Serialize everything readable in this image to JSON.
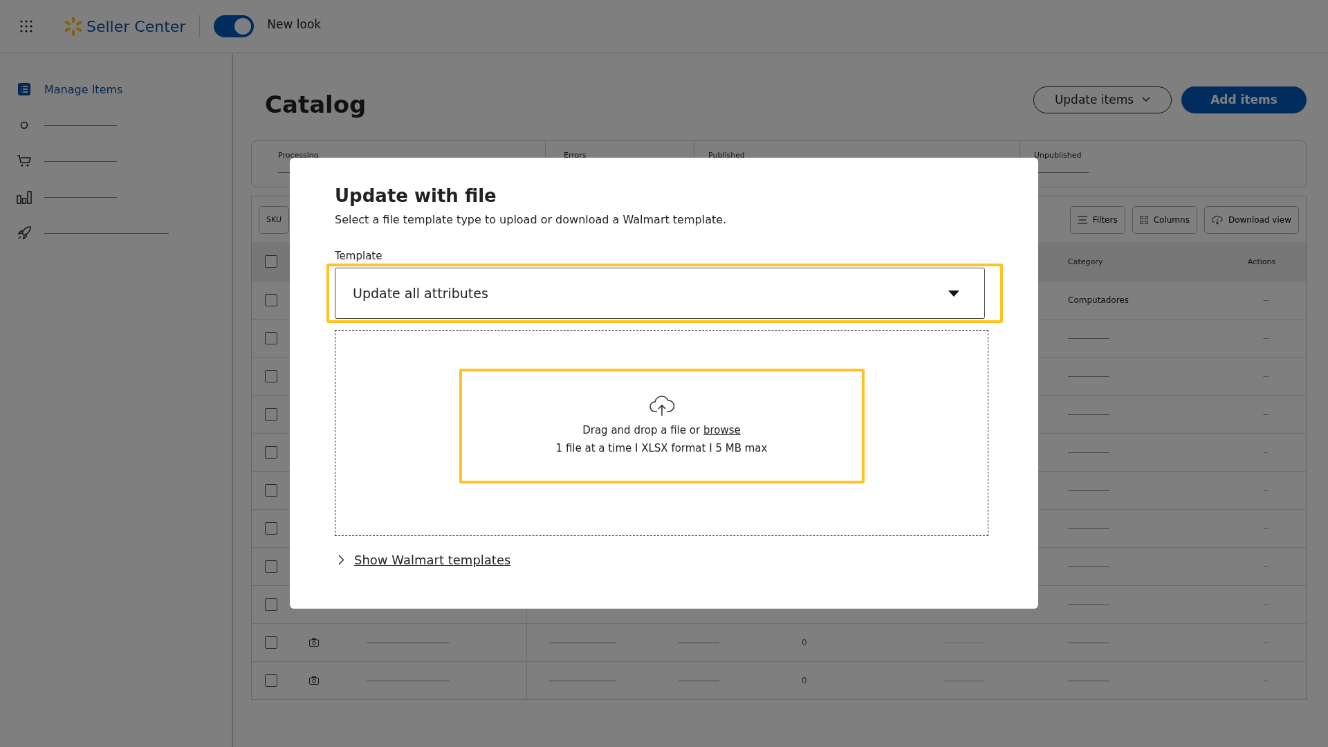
{
  "topbar": {
    "app_name": "Seller Center",
    "toggle": {
      "label": "New look",
      "on": true
    }
  },
  "sidebar": {
    "items": [
      {
        "label": "Manage Items",
        "selected": true
      },
      {
        "selected": false
      },
      {
        "selected": false
      },
      {
        "selected": false
      },
      {
        "selected": false
      }
    ]
  },
  "header": {
    "title": "Catalog",
    "buttons": [
      {
        "label": "Update items",
        "kind": "dropdown"
      },
      {
        "label": "Add items",
        "kind": "primary"
      }
    ]
  },
  "status_tabs": [
    {
      "label": "Processing"
    },
    {
      "label": "Errors"
    },
    {
      "label": "Published"
    },
    {
      "label": "Unpublished"
    }
  ],
  "toolbar": {
    "search_prefix": "SKU",
    "buttons": [
      {
        "label": "Filters",
        "kind": "filters"
      },
      {
        "label": "Columns",
        "kind": "columns"
      },
      {
        "label": "Download view",
        "kind": "download"
      }
    ]
  },
  "table": {
    "columns": [
      "Category",
      "Actions"
    ],
    "select_all_checked": false,
    "rows": [
      {
        "checked": false,
        "category": "Computadores",
        "actions": "--"
      },
      {
        "checked": false,
        "actions": "--"
      },
      {
        "checked": false,
        "actions": "--"
      },
      {
        "checked": false,
        "actions": "--"
      },
      {
        "checked": false,
        "actions": "--"
      },
      {
        "checked": false,
        "actions": "--"
      },
      {
        "checked": false,
        "actions": "--"
      },
      {
        "checked": false,
        "actions": "--"
      },
      {
        "checked": false,
        "actions": "--"
      },
      {
        "checked": false,
        "count": "0",
        "actions": "--"
      },
      {
        "checked": false,
        "count": "0",
        "actions": "--"
      }
    ]
  },
  "modal": {
    "title": "Update with file",
    "subtitle": "Select a file template type to upload or download a Walmart template.",
    "template_label": "Template",
    "template_value": "Update all attributes",
    "drop_text": "Drag and drop a file or",
    "browse_link": "browse",
    "drop_hint": "1 file at a time I XLSX format I 5 MB max",
    "expander": {
      "label": "Show Walmart templates",
      "expanded": false
    }
  }
}
